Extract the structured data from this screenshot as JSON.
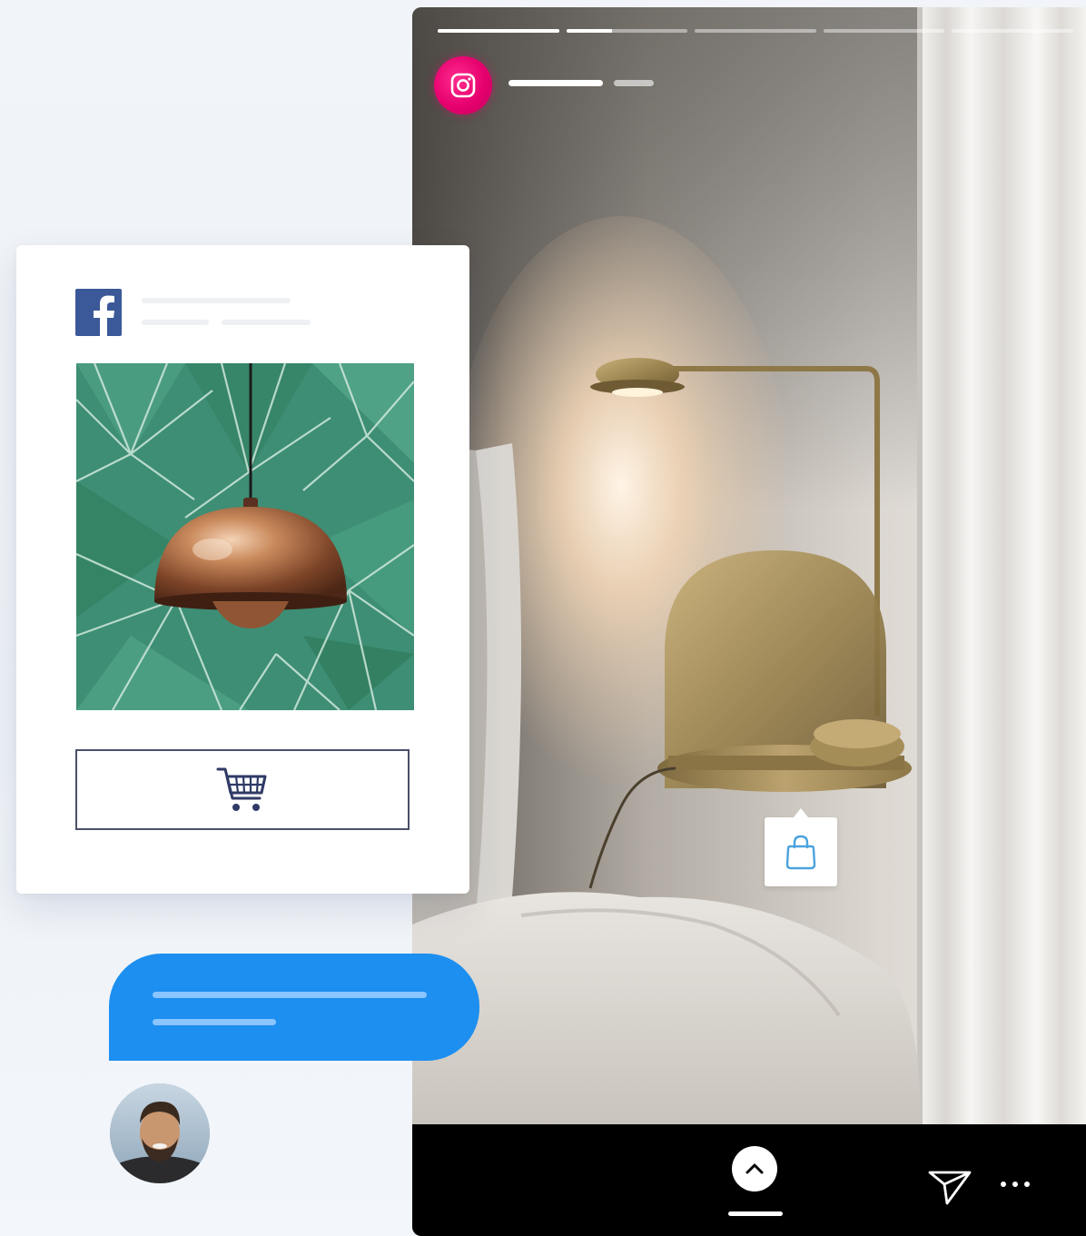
{
  "story": {
    "progress": [
      1,
      0.38,
      0,
      0,
      0
    ],
    "icons": {
      "platform": "instagram-icon",
      "shop_tag": "shopping-bag-icon",
      "swipe_up": "chevron-up-icon",
      "send": "send-icon",
      "more": "more-horizontal-icon"
    }
  },
  "facebook_card": {
    "icons": {
      "platform": "facebook-icon",
      "cart": "shopping-cart-icon"
    }
  },
  "chat": {
    "avatar": "avatar"
  },
  "colors": {
    "instagram_pink": "#e6006e",
    "facebook_blue": "#3b5998",
    "chat_blue": "#1c8ff0",
    "story_bar": "#000000",
    "background": "#f1f4f8"
  }
}
